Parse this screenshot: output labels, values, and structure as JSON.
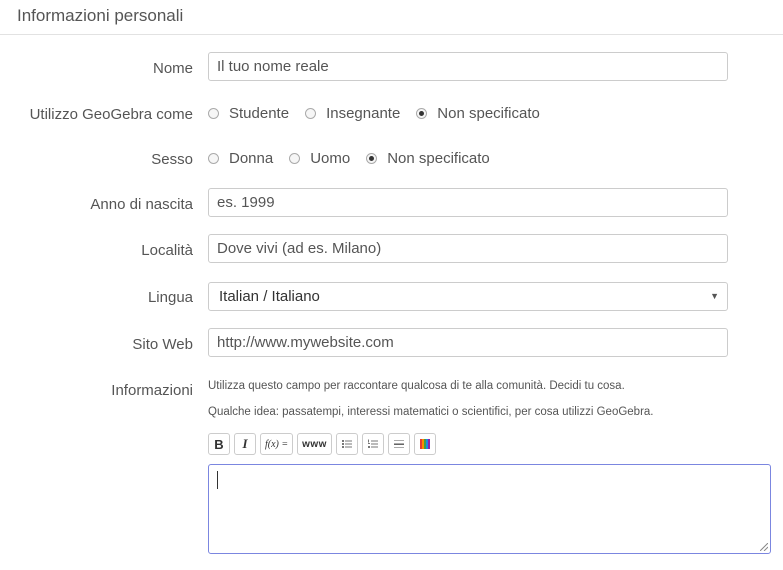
{
  "section_title": "Informazioni personali",
  "name": {
    "label": "Nome",
    "placeholder": "Il tuo nome reale"
  },
  "usage": {
    "label": "Utilizzo GeoGebra come",
    "options": [
      "Studente",
      "Insegnante",
      "Non specificato"
    ],
    "selected": "Non specificato"
  },
  "gender": {
    "label": "Sesso",
    "options": [
      "Donna",
      "Uomo",
      "Non specificato"
    ],
    "selected": "Non specificato"
  },
  "birth_year": {
    "label": "Anno di nascita",
    "placeholder": "es. 1999"
  },
  "location": {
    "label": "Località",
    "placeholder": "Dove vivi (ad es. Milano)"
  },
  "language": {
    "label": "Lingua",
    "value": "Italian / Italiano"
  },
  "website": {
    "label": "Sito Web",
    "placeholder": "http://www.mywebsite.com"
  },
  "about": {
    "label": "Informazioni",
    "hint1": "Utilizza questo campo per raccontare qualcosa di te alla comunità. Decidi tu cosa.",
    "hint2": "Qualche idea: passatempi, interessi matematici o scientifici, per cosa utilizzi GeoGebra.",
    "toolbar": {
      "bold": "B",
      "italic": "I",
      "formula": "f(x) =",
      "link": "www"
    },
    "value": ""
  }
}
